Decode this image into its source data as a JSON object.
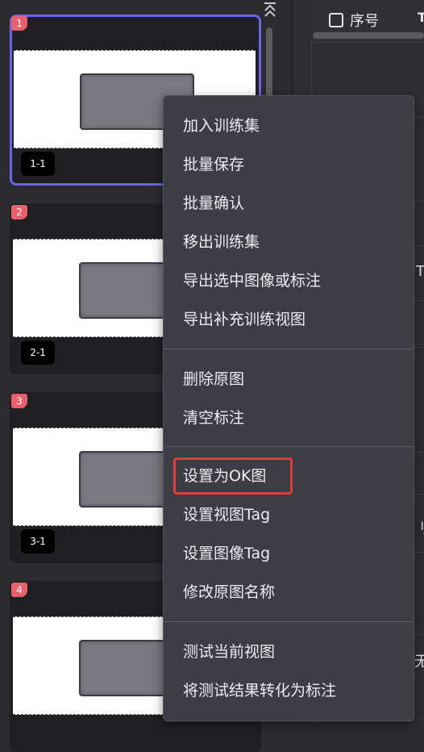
{
  "thumbnails": [
    {
      "index": "1",
      "view_label": "1-1",
      "selected": true
    },
    {
      "index": "2",
      "view_label": "2-1",
      "selected": false
    },
    {
      "index": "3",
      "view_label": "3-1",
      "selected": false
    },
    {
      "index": "4",
      "view_label": "",
      "selected": false
    }
  ],
  "right_panel": {
    "column_header": "序号",
    "column_header_2": "T",
    "peek_texts": [
      "T",
      "刂",
      "无"
    ]
  },
  "context_menu": {
    "groups": [
      [
        "加入训练集",
        "批量保存",
        "批量确认",
        "移出训练集",
        "导出选中图像或标注",
        "导出补充训练视图"
      ],
      [
        "删除原图",
        "清空标注"
      ],
      [
        "设置为OK图",
        "设置视图Tag",
        "设置图像Tag",
        "修改原图名称"
      ],
      [
        "测试当前视图",
        "将测试结果转化为标注"
      ]
    ],
    "highlighted_item": "设置为OK图"
  },
  "colors": {
    "selected_border": "#6b63e8",
    "badge": "#e8606a",
    "highlight_box": "#e23b3b",
    "menu_bg": "#3d3d46"
  }
}
